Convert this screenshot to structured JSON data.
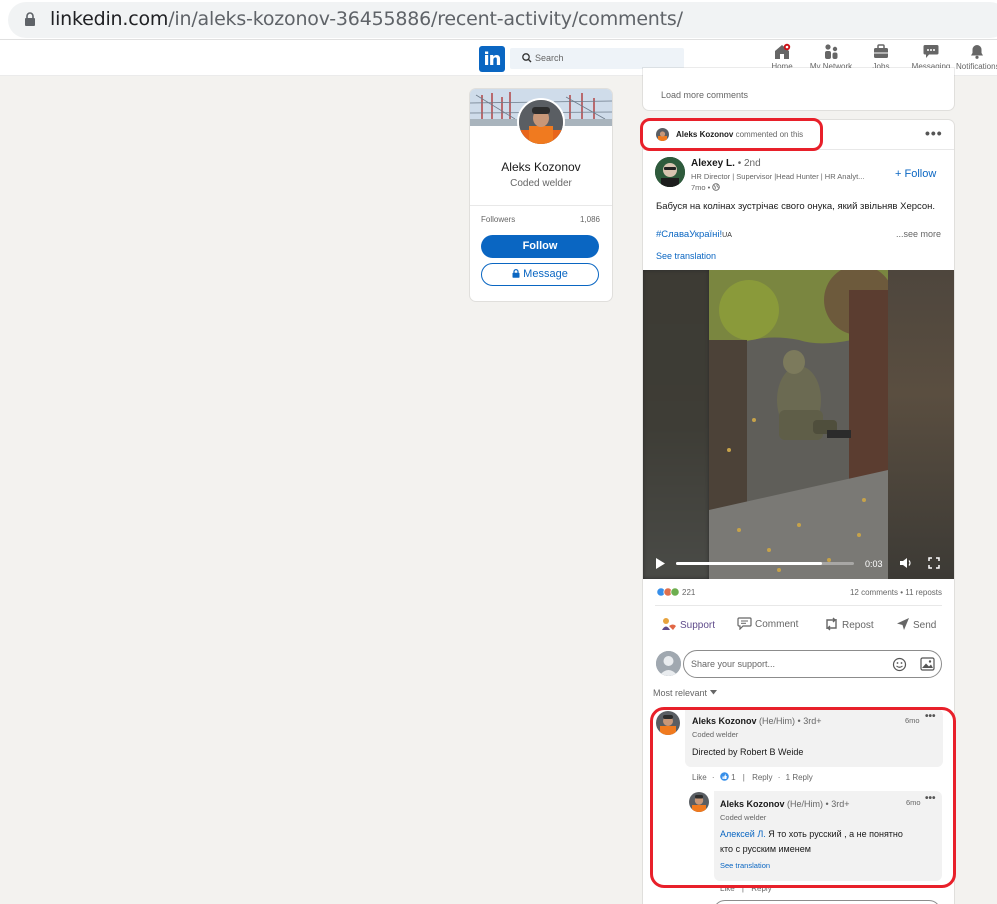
{
  "browser": {
    "url_host": "linkedin.com",
    "url_path": "/in/aleks-kozonov-36455886/recent-activity/comments/"
  },
  "nav": {
    "search_placeholder": "Search",
    "items": [
      {
        "label": "Home",
        "icon": "home-icon"
      },
      {
        "label": "My Network",
        "icon": "network-icon"
      },
      {
        "label": "Jobs",
        "icon": "briefcase-icon"
      },
      {
        "label": "Messaging",
        "icon": "messaging-icon"
      },
      {
        "label": "Notifications",
        "icon": "bell-icon"
      }
    ],
    "logo_text": "in"
  },
  "profile": {
    "name": "Aleks Kozonov",
    "headline": "Coded welder",
    "followers_label": "Followers",
    "followers_count": "1,086",
    "follow_label": "Follow",
    "message_label": "Message"
  },
  "feed": {
    "load_more": "Load more comments",
    "post": {
      "activity_actor": "Aleks Kozonov",
      "activity_text": "commented on this",
      "author_name": "Alexey L.",
      "author_degree": "• 2nd",
      "author_headline": "HR Director | Supervisor |Head Hunter | HR Analyt...",
      "author_time": "7mo •",
      "follow_label": "+ Follow",
      "text": "Бабуся на колінах зустрічає свого онука, який звільняв Херсон.",
      "hashtag": "#СлаваУкраїні!",
      "hashtag_suffix": "UA",
      "see_more": "...see more",
      "see_translation": "See translation",
      "video_time": "0:03",
      "video_progress": 0.82,
      "reaction_count": "221",
      "comments_reposts": "12 comments • 11 reposts",
      "actions": [
        "Support",
        "Comment",
        "Repost",
        "Send"
      ],
      "share_placeholder": "Share your support...",
      "sort_label": "Most relevant"
    },
    "comments": [
      {
        "name": "Aleks Kozonov",
        "pronouns": "(He/Him)",
        "degree": "• 3rd+",
        "time": "6mo",
        "headline": "Coded welder",
        "text": "Directed by Robert B Weide",
        "like_label": "Like",
        "like_count": "1",
        "reply_label": "Reply",
        "reply_count": "1 Reply"
      },
      {
        "name": "Aleks Kozonov",
        "pronouns": "(He/Him)",
        "degree": "• 3rd+",
        "time": "6mo",
        "headline": "Coded welder",
        "mention": "Алексей Л.",
        "text_line1": "Я то хоть русский , а не понятно",
        "text_line2": "кто с русским именем",
        "see_translation": "See translation",
        "like_label": "Like",
        "reply_label": "Reply"
      }
    ]
  },
  "colors": {
    "brand": "#0a66c2",
    "annotation_red": "#e8202a",
    "page_bg": "#f3f2ef"
  }
}
